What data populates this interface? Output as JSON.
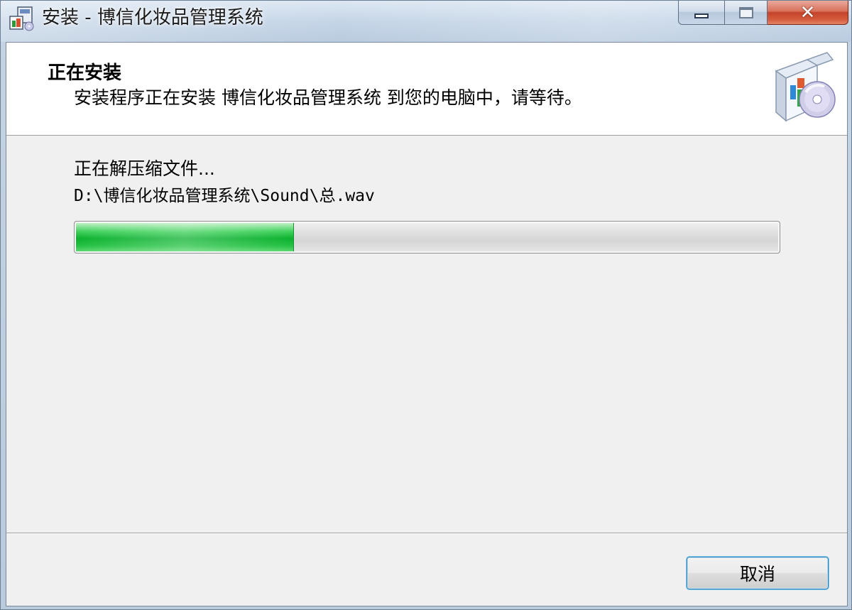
{
  "window": {
    "title": "安装 - 博信化妆品管理系统",
    "caption_buttons": {
      "minimize": "minimize",
      "maximize": "maximize",
      "close": "✕"
    }
  },
  "header": {
    "title": "正在安装",
    "subtitle": "安装程序正在安装 博信化妆品管理系统 到您的电脑中，请等待。",
    "icon": "installer-box-disc-icon"
  },
  "body": {
    "status": "正在解压缩文件...",
    "file_path": "D:\\博信化妆品管理系统\\Sound\\总.wav",
    "progress_fraction": 0.31
  },
  "footer": {
    "cancel_label": "取消"
  },
  "colors": {
    "progress_green": "#0cb12f",
    "close_red": "#c3442a",
    "client_bg": "#f0f0f0"
  }
}
